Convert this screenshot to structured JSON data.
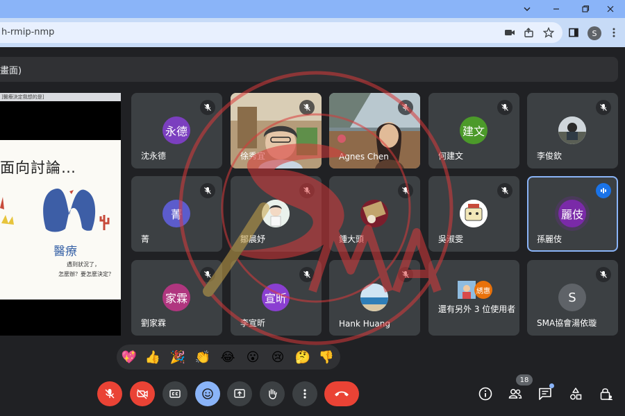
{
  "browser": {
    "url": "h-rmip-nmp",
    "profile_initial": "S"
  },
  "header": {
    "presenting_label": "畫面)"
  },
  "presentation": {
    "topbar_text": "]醫療決定我想的是]",
    "slide_title": "面向討論…",
    "slide_word": "醫療",
    "caption_line1": "遇到狀況了，",
    "caption_line2": "怎麼辦？要怎麼決定？"
  },
  "tiles": [
    {
      "name": "沈永德",
      "avatar_text": "永德",
      "avatar_color": "#7b3fbf",
      "mic": "off"
    },
    {
      "name": "徐秀宜",
      "avatar_text": "",
      "avatar_color": "",
      "mic": "off"
    },
    {
      "name": "Agnes Chen",
      "avatar_text": "",
      "avatar_color": "",
      "mic": "off"
    },
    {
      "name": "何建文",
      "avatar_text": "建文",
      "avatar_color": "#4c9a2a",
      "mic": "off"
    },
    {
      "name": "李俊欽",
      "avatar_text": "",
      "avatar_color": "",
      "mic": "off"
    },
    {
      "name": "菁",
      "avatar_text": "菁",
      "avatar_color": "#5c5ccc",
      "mic": "off"
    },
    {
      "name": "鄒晨妤",
      "avatar_text": "",
      "avatar_color": "",
      "mic": "off"
    },
    {
      "name": "鍾大頭",
      "avatar_text": "",
      "avatar_color": "",
      "mic": "off"
    },
    {
      "name": "吳淑雯",
      "avatar_text": "",
      "avatar_color": "",
      "mic": "off"
    },
    {
      "name": "孫麗伎",
      "avatar_text": "麗伎",
      "avatar_color": "#7a2aa8",
      "mic": "speaking"
    },
    {
      "name": "劉家霖",
      "avatar_text": "家霖",
      "avatar_color": "#b0367f",
      "mic": "off"
    },
    {
      "name": "李宣昕",
      "avatar_text": "宣昕",
      "avatar_color": "#8a3fd1",
      "mic": "off"
    },
    {
      "name": "Hank Huang",
      "avatar_text": "",
      "avatar_color": "",
      "mic": "off"
    },
    {
      "name": "還有另外 3 位使用者",
      "avatar_text": "綉惠",
      "avatar_color": "#e8710a",
      "mic": "none"
    },
    {
      "name": "SMA協會湯依璇",
      "avatar_text": "S",
      "avatar_color": "#5f6368",
      "mic": "off"
    }
  ],
  "reactions": [
    "💖",
    "👍",
    "🎉",
    "👏",
    "😂",
    "😮",
    "😢",
    "🤔",
    "👎"
  ],
  "controls": {
    "participant_count": "18"
  },
  "colors": {
    "meet_bg": "#202124",
    "tile_bg": "#3c4043",
    "accent_blue": "#8ab4f8",
    "danger_red": "#ea4335",
    "watermark_red": "#d93a3a"
  }
}
